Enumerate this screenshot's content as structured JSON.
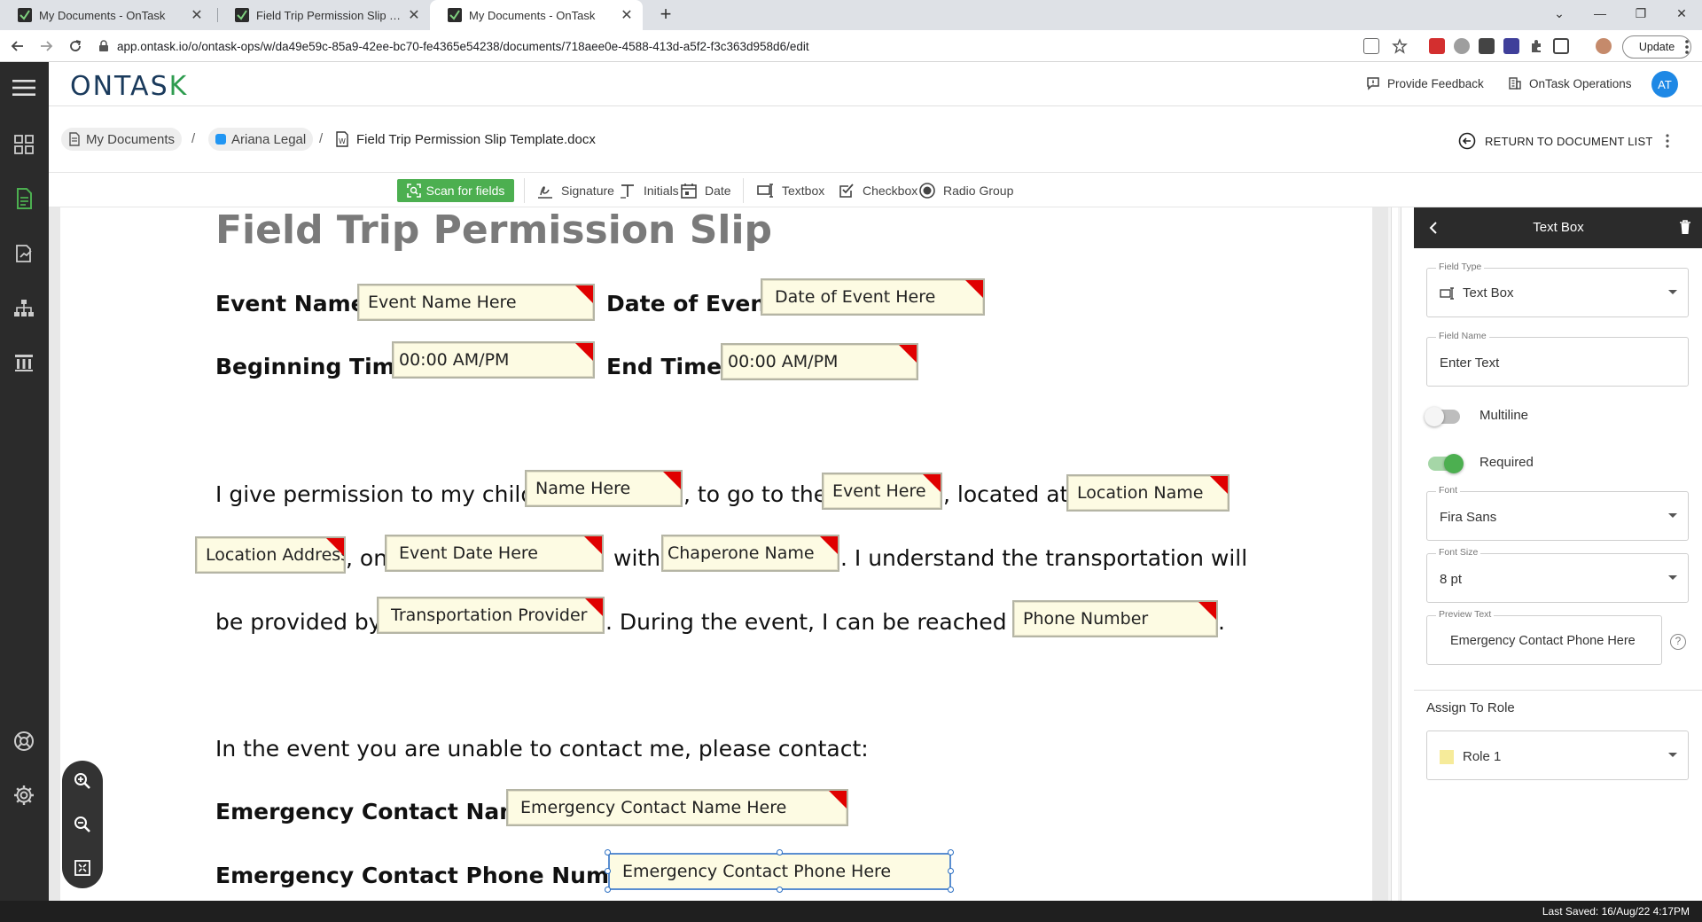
{
  "browser": {
    "tabs": [
      {
        "title": "My Documents - OnTask",
        "active": false
      },
      {
        "title": "Field Trip Permission Slip Templat",
        "active": false
      },
      {
        "title": "My Documents - OnTask",
        "active": true
      }
    ],
    "url": "app.ontask.io/o/ontask-ops/w/da49e59c-85a9-42ee-bc70-fe4365e54238/documents/718aee0e-4588-413d-a5f2-f3c363d958d6/edit",
    "update_label": "Update"
  },
  "header": {
    "logo_main": "ONTAS",
    "logo_k": "K",
    "feedback": "Provide Feedback",
    "org": "OnTask Operations",
    "avatar": "AT"
  },
  "breadcrumb": {
    "root": "My Documents",
    "folder": "Ariana Legal",
    "document": "Field Trip Permission Slip Template.docx",
    "sep": "/",
    "return_label": "RETURN TO DOCUMENT LIST"
  },
  "toolbar": {
    "scan": "Scan for fields",
    "tools": [
      "Signature",
      "Initials",
      "Date",
      "Textbox",
      "Checkbox",
      "Radio Group"
    ]
  },
  "document": {
    "title": "Field Trip Permission Slip",
    "labels": {
      "event_name": "Event Name",
      "date_of_event": "Date of Event",
      "beginning_time": "Beginning Time",
      "end_time": "End Time",
      "colon": ":",
      "p1": "I give permission to my child,",
      "p2": ", to go to the",
      "p3": ", located at",
      "p4": ", on",
      "p5": "with",
      "p6": ". I understand the transportation will",
      "p7": "be provided by",
      "p8": ". During the event, I can be reached at",
      "p9": ".",
      "unable": "In the event you are unable to contact me, please contact:",
      "ec_name": "Emergency Contact Name",
      "ec_phone": "Emergency Contact Phone Number"
    },
    "fields": {
      "event_name": "Event Name Here",
      "date_of_event": "Date of Event Here",
      "begin_time": "00:00 AM/PM",
      "end_time": "00:00 AM/PM",
      "child_name": "Name Here",
      "event": "Event Here",
      "location_name": "Location Name",
      "location_address": "Location Address",
      "event_date": "Event Date Here",
      "chaperone": "Chaperone Name",
      "transport": "Transportation Provider",
      "phone": "Phone Number",
      "ec_name": "Emergency Contact Name Here",
      "ec_phone": "Emergency Contact Phone Here"
    }
  },
  "panel": {
    "title": "Text Box",
    "field_type_caption": "Field Type",
    "field_type": "Text Box",
    "field_name_caption": "Field Name",
    "field_name": "Enter Text",
    "multiline": "Multiline",
    "multiline_on": false,
    "required": "Required",
    "required_on": true,
    "font_caption": "Font",
    "font": "Fira Sans",
    "font_size_caption": "Font Size",
    "font_size": "8 pt",
    "preview_caption": "Preview Text",
    "preview": "Emergency Contact Phone Here",
    "help": "?",
    "assign_role": "Assign To Role",
    "role": "Role 1",
    "role_color": "#f6eb9a"
  },
  "status": {
    "last_saved": "Last Saved: 16/Aug/22 4:17PM"
  },
  "colors": {
    "accent_green": "#4caf50",
    "rail": "#2b2b2b",
    "field_bg": "#fdfbe3",
    "flag_red": "#e00000",
    "avatar_blue": "#1e88e5"
  }
}
